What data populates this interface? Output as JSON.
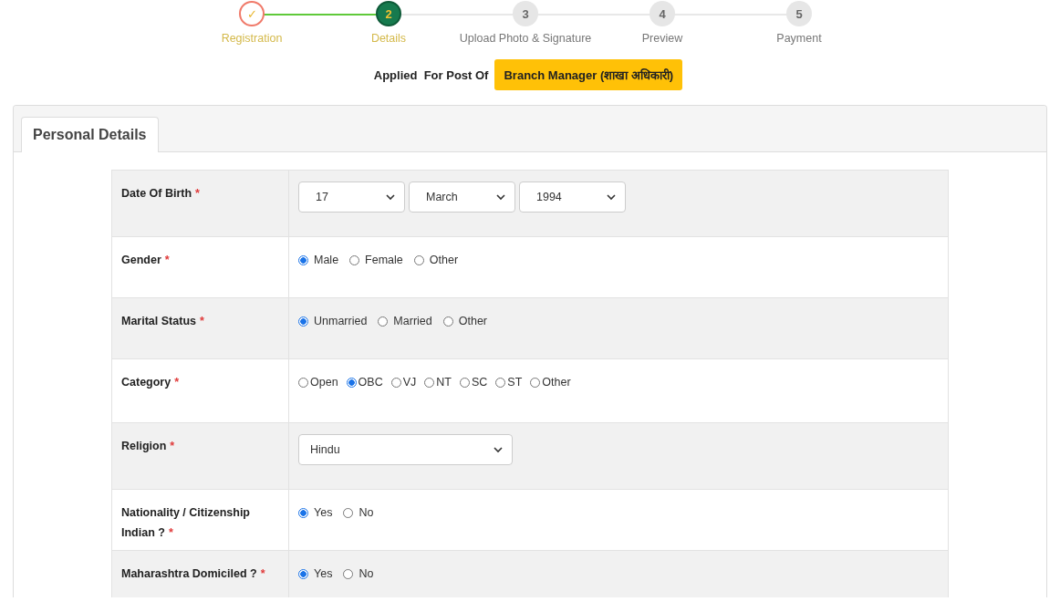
{
  "stepper": {
    "steps": [
      {
        "marker": "✓",
        "label": "Registration",
        "completed": true,
        "selected": false
      },
      {
        "marker": "2",
        "label": "Details",
        "completed": false,
        "selected": true
      },
      {
        "marker": "3",
        "label": "Upload Photo & Signature",
        "completed": false,
        "selected": false
      },
      {
        "marker": "4",
        "label": "Preview",
        "completed": false,
        "selected": false
      },
      {
        "marker": "5",
        "label": "Payment",
        "completed": false,
        "selected": false
      }
    ]
  },
  "applied_post": {
    "label": "Applied  For Post Of",
    "post": "Branch Manager (शाखा अधिकारी)"
  },
  "card": {
    "tabs": [
      {
        "label": "Personal Details",
        "selected": true
      }
    ],
    "rows": [
      {
        "kind": "selects",
        "label": "Date Of Birth",
        "mark": "*",
        "selects": [
          {
            "value": "17"
          },
          {
            "value": "March"
          },
          {
            "value": "1994"
          }
        ]
      },
      {
        "kind": "radios",
        "label": "Gender",
        "mark": "*",
        "options": [
          {
            "label": "Male",
            "selected": true
          },
          {
            "label": "Female",
            "selected": false
          },
          {
            "label": "Other",
            "selected": false
          }
        ]
      },
      {
        "kind": "radios",
        "label": "Marital Status",
        "mark": "*",
        "options": [
          {
            "label": "Unmarried",
            "selected": true
          },
          {
            "label": "Married",
            "selected": false
          },
          {
            "label": "Other",
            "selected": false
          }
        ]
      },
      {
        "kind": "tightradios",
        "label": "Category",
        "mark": "*",
        "options": [
          {
            "label": "Open",
            "selected": false
          },
          {
            "label": "OBC",
            "selected": true
          },
          {
            "label": "VJ",
            "selected": false
          },
          {
            "label": "NT",
            "selected": false
          },
          {
            "label": "SC",
            "selected": false
          },
          {
            "label": "ST",
            "selected": false
          },
          {
            "label": "Other",
            "selected": false
          }
        ]
      },
      {
        "kind": "select",
        "label": "Religion",
        "mark": "*",
        "selects": [
          {
            "value": "Hindu"
          }
        ]
      },
      {
        "kind": "radios",
        "label": "Nationality / Citizenship Indian ?",
        "mark": "*",
        "options": [
          {
            "label": "Yes",
            "selected": true
          },
          {
            "label": "No",
            "selected": false
          }
        ]
      },
      {
        "kind": "radios",
        "label": "Maharashtra Domiciled ?",
        "mark": "*",
        "options": [
          {
            "label": "Yes",
            "selected": true
          },
          {
            "label": "No",
            "selected": false
          }
        ]
      }
    ]
  }
}
